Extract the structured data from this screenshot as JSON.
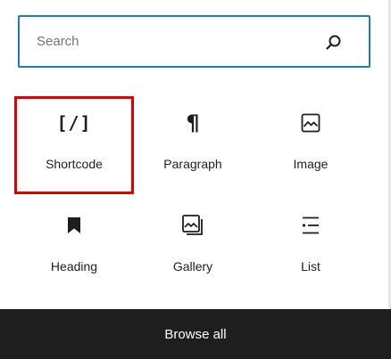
{
  "search": {
    "placeholder": "Search",
    "value": ""
  },
  "blocks": [
    {
      "label": "Shortcode",
      "icon": "shortcode-icon",
      "glyph": "[/]"
    },
    {
      "label": "Paragraph",
      "icon": "paragraph-icon",
      "glyph": "¶"
    },
    {
      "label": "Image",
      "icon": "image-icon"
    },
    {
      "label": "Heading",
      "icon": "bookmark-icon"
    },
    {
      "label": "Gallery",
      "icon": "gallery-icon"
    },
    {
      "label": "List",
      "icon": "list-icon"
    }
  ],
  "footer": {
    "browse_all_label": "Browse all"
  },
  "colors": {
    "accent": "#1f7db2",
    "highlight": "#e00000",
    "footer_bg": "#1e1e1e",
    "text": "#1e1e1e"
  }
}
